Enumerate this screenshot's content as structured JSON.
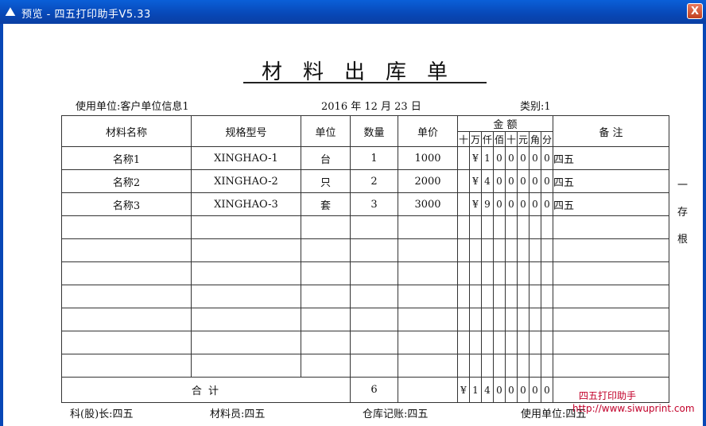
{
  "window": {
    "title": "预览 - 四五打印助手V5.33",
    "icon": "mountain-logo-icon",
    "close_label": "X"
  },
  "doc": {
    "title": "材料出库单",
    "use_unit_label": "使用单位:客户单位信息1",
    "date_text": "2016 年 12 月 23 日",
    "category_label": "类别:1"
  },
  "headers": {
    "name": "材料名称",
    "model": "规格型号",
    "unit": "单位",
    "qty": "数量",
    "price": "单价",
    "amount": "金  额",
    "remark": "备  注",
    "digits": [
      "十",
      "万",
      "仟",
      "佰",
      "十",
      "元",
      "角",
      "分"
    ]
  },
  "rows": [
    {
      "name": "名称1",
      "model": "XINGHAO-1",
      "unit": "台",
      "qty": "1",
      "price": "1000",
      "digits": [
        "",
        "¥",
        "1",
        "0",
        "0",
        "0",
        "0",
        "0"
      ],
      "remark": "四五"
    },
    {
      "name": "名称2",
      "model": "XINGHAO-2",
      "unit": "只",
      "qty": "2",
      "price": "2000",
      "digits": [
        "",
        "¥",
        "4",
        "0",
        "0",
        "0",
        "0",
        "0"
      ],
      "remark": "四五"
    },
    {
      "name": "名称3",
      "model": "XINGHAO-3",
      "unit": "套",
      "qty": "3",
      "price": "3000",
      "digits": [
        "",
        "¥",
        "9",
        "0",
        "0",
        "0",
        "0",
        "0"
      ],
      "remark": "四五"
    }
  ],
  "total": {
    "label": "合    计",
    "qty": "6",
    "digits": [
      "¥",
      "1",
      "4",
      "0",
      "0",
      "0",
      "0",
      "0"
    ]
  },
  "side_text": [
    "一",
    "存",
    "根"
  ],
  "footer": {
    "chief": "科(股)长:四五",
    "material_clerk": "材料员:四五",
    "warehouse": "仓库记账:四五",
    "use_unit": "使用单位:四五"
  },
  "watermark": {
    "line1": "四五打印助手",
    "line2": "http://www.siwuprint.com"
  }
}
